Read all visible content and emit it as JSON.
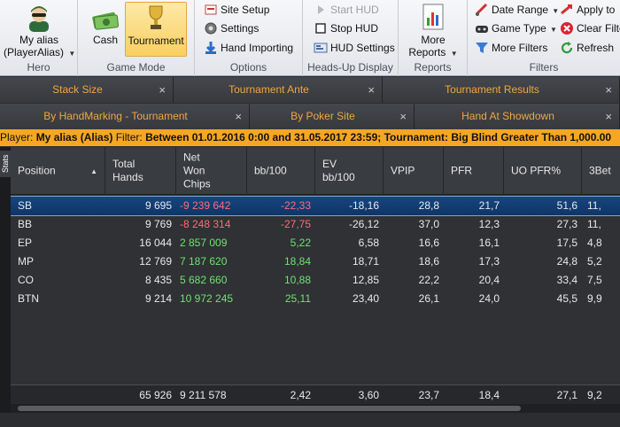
{
  "ribbon": {
    "hero": {
      "alias": "My alias",
      "alias_sub": "(PlayerAlias)",
      "group_label": "Hero"
    },
    "game_mode": {
      "cash_label": "Cash",
      "tournament_label": "Tournament",
      "group_label": "Game Mode"
    },
    "options": {
      "site_setup": "Site Setup",
      "settings": "Settings",
      "hand_importing": "Hand Importing",
      "group_label": "Options"
    },
    "hud": {
      "start": "Start HUD",
      "stop": "Stop HUD",
      "settings": "HUD Settings",
      "group_label": "Heads-Up Display"
    },
    "reports": {
      "more_label": "More",
      "reports_label": "Reports",
      "group_label": "Reports"
    },
    "filters": {
      "date_range": "Date Range",
      "game_type": "Game Type",
      "more_filters": "More Filters",
      "apply": "Apply to",
      "clear": "Clear Filte",
      "refresh": "Refresh",
      "group_label": "Filters"
    }
  },
  "filter_tabs_row1": [
    {
      "label": "Stack Size"
    },
    {
      "label": "Tournament Ante"
    },
    {
      "label": "Tournament Results"
    }
  ],
  "filter_tabs_row2": [
    {
      "label": "By HandMarking - Tournament"
    },
    {
      "label": "By Poker Site"
    },
    {
      "label": "Hand At Showdown"
    }
  ],
  "close_glyph": "×",
  "info": {
    "player_prefix": "Player: ",
    "player": "My alias (Alias)",
    "filter_prefix": "  Filter: ",
    "filter": "Between 01.01.2016 0:00 and 31.05.2017 23:59; Tournament: Big Blind Greater Than 1,000.00"
  },
  "side_tab": "Stats",
  "grid": {
    "columns": [
      {
        "label": "Position"
      },
      {
        "label": "Total\nHands"
      },
      {
        "label": "Net\nWon\nChips"
      },
      {
        "label": "bb/100"
      },
      {
        "label": "EV\nbb/100"
      },
      {
        "label": "VPIP"
      },
      {
        "label": "PFR"
      },
      {
        "label": "UO PFR%"
      },
      {
        "label": "3Bet"
      }
    ],
    "rows": [
      {
        "pos": "SB",
        "hands": "9 695",
        "won": "-9 239 642",
        "bb": "-22,33",
        "ev": "-18,16",
        "vpip": "28,8",
        "pfr": "21,7",
        "uo": "51,6",
        "three": "11,"
      },
      {
        "pos": "BB",
        "hands": "9 769",
        "won": "-8 248 314",
        "bb": "-27,75",
        "ev": "-26,12",
        "vpip": "37,0",
        "pfr": "12,3",
        "uo": "27,3",
        "three": "11,"
      },
      {
        "pos": "EP",
        "hands": "16 044",
        "won": "2 857 009",
        "bb": "5,22",
        "ev": "6,58",
        "vpip": "16,6",
        "pfr": "16,1",
        "uo": "17,5",
        "three": "4,8"
      },
      {
        "pos": "MP",
        "hands": "12 769",
        "won": "7 187 620",
        "bb": "18,84",
        "ev": "18,71",
        "vpip": "18,6",
        "pfr": "17,3",
        "uo": "24,8",
        "three": "5,2"
      },
      {
        "pos": "CO",
        "hands": "8 435",
        "won": "5 682 660",
        "bb": "10,88",
        "ev": "12,85",
        "vpip": "22,2",
        "pfr": "20,4",
        "uo": "33,4",
        "three": "7,5"
      },
      {
        "pos": "BTN",
        "hands": "9 214",
        "won": "10 972 245",
        "bb": "25,11",
        "ev": "23,40",
        "vpip": "26,1",
        "pfr": "24,0",
        "uo": "45,5",
        "three": "9,9"
      }
    ],
    "totals": {
      "hands": "65 926",
      "won": "9 211 578",
      "bb": "2,42",
      "ev": "3,60",
      "vpip": "23,7",
      "pfr": "18,4",
      "uo": "27,1",
      "three": "9,2"
    }
  },
  "colors": {
    "accent_orange": "#f5a623",
    "tab_text": "#f0a640",
    "negative": "#ff6b7a",
    "positive": "#6fe36f",
    "selection": "#17457f"
  }
}
